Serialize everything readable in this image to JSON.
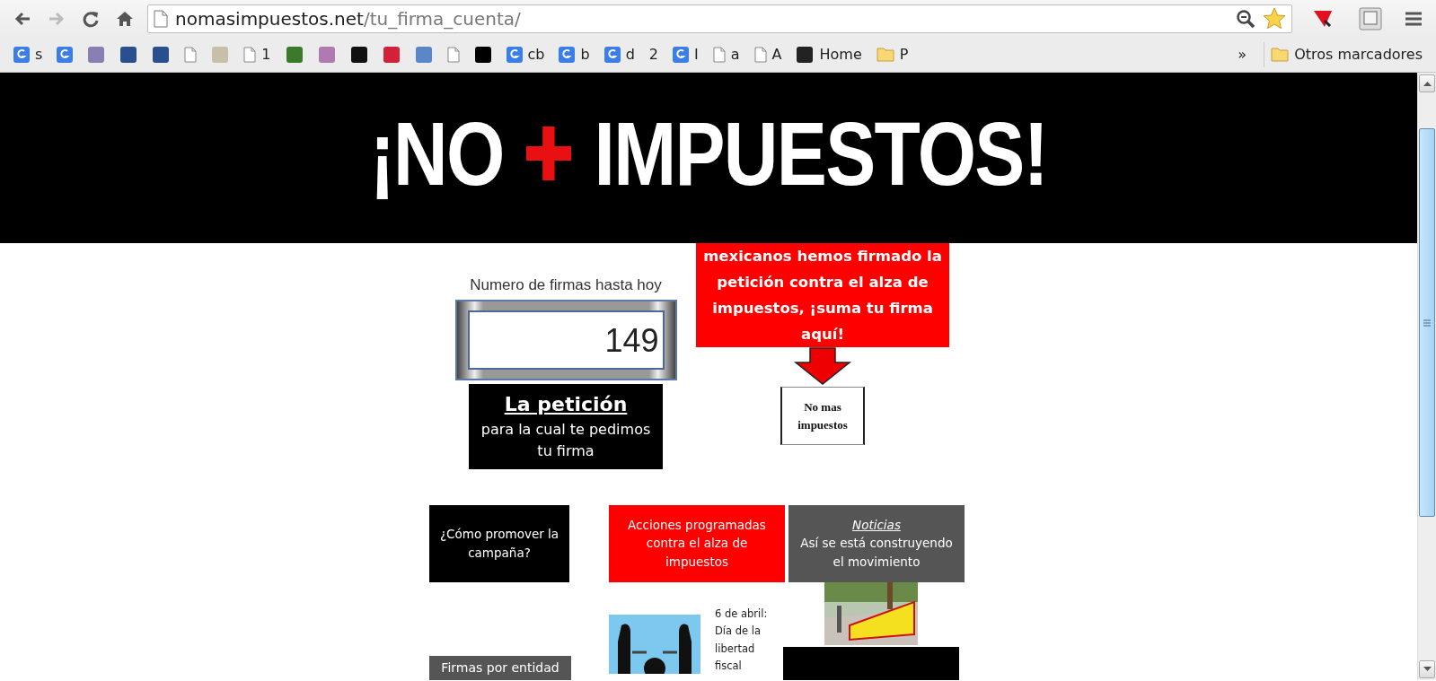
{
  "browser": {
    "nav_buttons": [
      {
        "kind": "back",
        "disabled": false
      },
      {
        "kind": "forward",
        "disabled": true
      },
      {
        "kind": "reload",
        "disabled": false
      },
      {
        "kind": "home",
        "disabled": false
      }
    ],
    "url": {
      "host": "nomasimpuestos.net",
      "path": "/tu_firma_cuenta/"
    },
    "bookmarks": [
      {
        "kind": "google",
        "label": "s"
      },
      {
        "kind": "google"
      },
      {
        "kind": "logo",
        "color": "#8a7fb5"
      },
      {
        "kind": "logo",
        "color": "#2a4f8f"
      },
      {
        "kind": "logo",
        "color": "#2a4f8f"
      },
      {
        "kind": "page"
      },
      {
        "kind": "logo",
        "color": "#c8bfa8"
      },
      {
        "kind": "page",
        "label": "1"
      },
      {
        "kind": "logo",
        "color": "#3a7a2a"
      },
      {
        "kind": "logo",
        "color": "#b07ab0"
      },
      {
        "kind": "logo",
        "color": "#111111"
      },
      {
        "kind": "logo",
        "color": "#d4213a"
      },
      {
        "kind": "logo",
        "color": "#5b87c9"
      },
      {
        "kind": "page"
      },
      {
        "kind": "logo",
        "color": "#000000"
      },
      {
        "kind": "google",
        "label": "cb"
      },
      {
        "kind": "google",
        "label": "b"
      },
      {
        "kind": "google",
        "label": "d"
      },
      {
        "kind": "blank",
        "label": "2"
      },
      {
        "kind": "google",
        "label": "I"
      },
      {
        "kind": "page",
        "label": "a"
      },
      {
        "kind": "page",
        "label": "A"
      },
      {
        "kind": "logo",
        "color": "#222222",
        "label": "Home"
      },
      {
        "kind": "folder",
        "label": "P"
      }
    ],
    "overflow": "»",
    "other_bookmarks": "Otros marcadores"
  },
  "page": {
    "banner": {
      "before": "¡NO",
      "after": "IMPUESTOS!"
    },
    "counter": {
      "label": "Numero de firmas hasta hoy",
      "value": "149"
    },
    "petition": {
      "title": "La petición",
      "subtitle": "para la cual te pedimos tu firma"
    },
    "callout": "mexicanos hemos firmado la petición contra el alza de impuestos, ¡suma tu firma aquí!",
    "sign_box": "No mas impuestos",
    "tiles": [
      {
        "kind": "black",
        "text": "¿Cómo promover la campaña?"
      },
      {
        "kind": "red",
        "text": "Acciones programadas contra el alza de impuestos"
      },
      {
        "kind": "gray",
        "heading": "Noticias",
        "text": "Así se está construyendo el movimiento"
      }
    ],
    "event": "6 de abril: Día de la libertad fiscal",
    "entity_tile": "Firmas por entidad"
  }
}
